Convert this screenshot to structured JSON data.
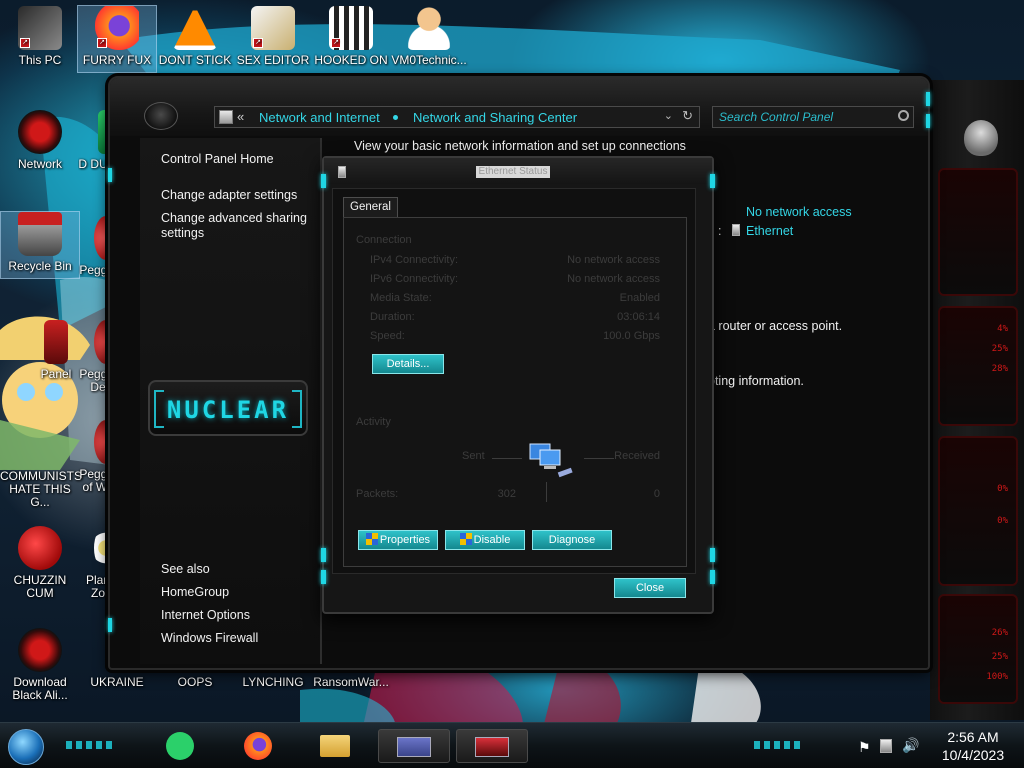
{
  "desktop": {
    "icons": [
      {
        "label": "This PC"
      },
      {
        "label": "FURRY FUX"
      },
      {
        "label": "DONT STICK"
      },
      {
        "label": "SEX EDITOR"
      },
      {
        "label": "HOOKED ON"
      },
      {
        "label": "VM0Technic..."
      },
      {
        "label": "Network"
      },
      {
        "label": "D DUM"
      },
      {
        "label": "Recycle Bin"
      },
      {
        "label": "Peggle"
      },
      {
        "label": "Panel"
      },
      {
        "label": "Peggle De"
      },
      {
        "label": "COMMUNISTS HATE THIS G..."
      },
      {
        "label": "Peggle of Wa"
      },
      {
        "label": "CHUZZIN CUM"
      },
      {
        "label": "Plan Zo"
      },
      {
        "label": "Download Black Ali..."
      },
      {
        "label": "UKRAINE"
      },
      {
        "label": "OOPS"
      },
      {
        "label": "LYNCHING"
      },
      {
        "label": "RansomWar..."
      }
    ]
  },
  "window": {
    "breadcrumb": [
      "Network and Internet",
      "Network and Sharing Center"
    ],
    "search_placeholder": "Search Control Panel",
    "nav": {
      "home": "Control Panel Home",
      "change_adapter": "Change adapter settings",
      "change_sharing": "Change advanced sharing settings",
      "see_also": "See also",
      "homegroup": "HomeGroup",
      "internet_options": "Internet Options",
      "firewall": "Windows Firewall",
      "logo_text": "NUCLEAR"
    },
    "content": {
      "heading": "View your basic network information and set up connections",
      "access_type": "No network access",
      "connections_colon": ":",
      "connection_name": "Ethernet",
      "router_text": "a router or access point.",
      "troubleshoot_text": "oting information."
    }
  },
  "dialog": {
    "title": "Ethernet Status",
    "tab": "General",
    "connection_group": "Connection",
    "rows": [
      {
        "label": "IPv4 Connectivity:",
        "value": "No network access"
      },
      {
        "label": "IPv6 Connectivity:",
        "value": "No network access"
      },
      {
        "label": "Media State:",
        "value": "Enabled"
      },
      {
        "label": "Duration:",
        "value": "03:06:14"
      },
      {
        "label": "Speed:",
        "value": "100.0 Gbps"
      }
    ],
    "details_btn": "Details...",
    "activity_group": "Activity",
    "sent_label": "Sent",
    "received_label": "Received",
    "packets_label": "Packets:",
    "packets_sent": "302",
    "packets_received": "0",
    "properties_btn": "Properties",
    "disable_btn": "Disable",
    "diagnose_btn": "Diagnose",
    "close_btn": "Close"
  },
  "rail": {
    "values": [
      "4%",
      "25%",
      "28%",
      "0%",
      "0%",
      "26%",
      "25%",
      "100%"
    ]
  },
  "taskbar": {
    "time": "2:56 AM",
    "date": "10/4/2023"
  },
  "colors": {
    "accent_cyan": "#34d6e6",
    "button_teal": "#1fa8b0",
    "alert_red": "#d01818"
  }
}
